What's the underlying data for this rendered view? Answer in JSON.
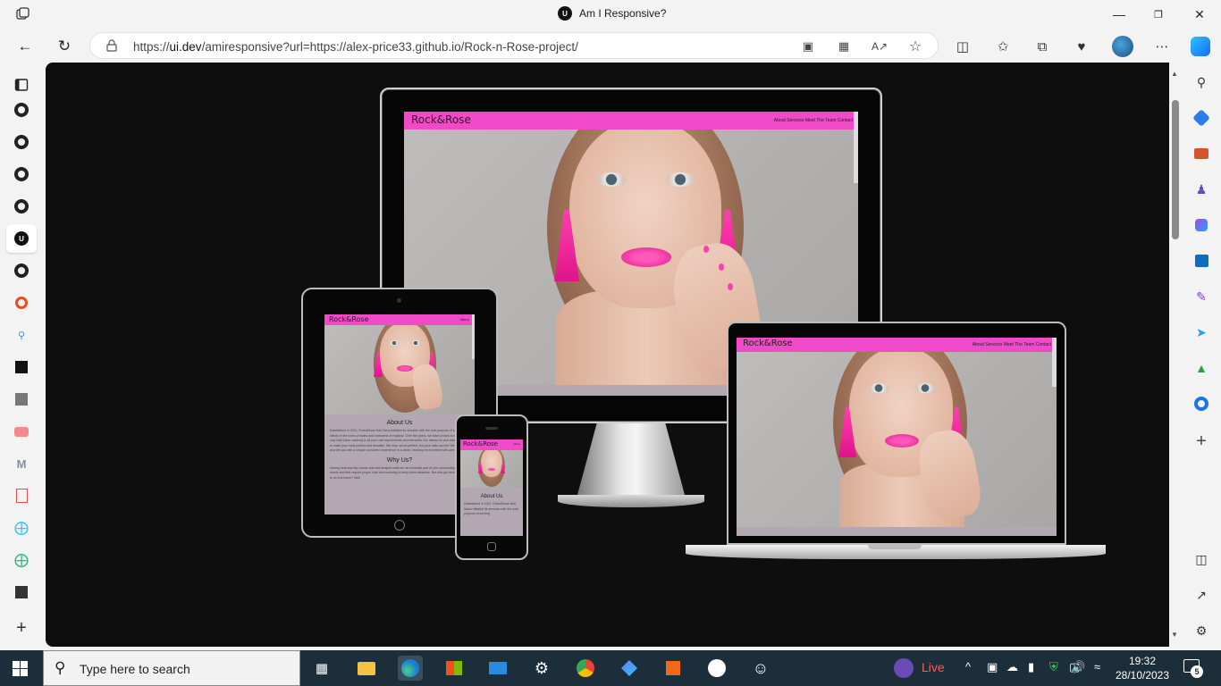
{
  "browser": {
    "tab_title": "Am I Responsive?",
    "url_prefix": "https://",
    "url_host": "ui.dev",
    "url_rest": "/amiresponsive?url=https://alex-price33.github.io/Rock-n-Rose-project/"
  },
  "sites": {
    "desktop": {
      "logo": "Rock&Rose",
      "nav_links": "About  Services  Meet The Team  Contact"
    },
    "laptop": {
      "logo": "Rock&Rose",
      "nav_links": "About  Services  Meet The Team  Contact"
    },
    "tablet": {
      "logo": "Rock&Rose",
      "menu": "Menu",
      "about_heading": "About Us",
      "about_text": "Established in 2011, Rock&Rose Nail Salon initiated its services with the sole purpose of serving clients in the north of wales and northwest of england. Over the years, we have proved to be the only Nail Salon catering to all your nail requirements and demands.Our mission is and always will be to make your nails perfect and beautiful. We may not be perfect, but your nails can be! We strive to provide you with a unique consumer experience in a clean, relaxing environment with care-to-detail.",
      "why_heading": "Why Us?",
      "why_text": "Having neat and tidy hands with well-shaped nails are an essential part of your personality. Our hands and feet require proper care and nurturing to keep them attractive. But who got enough time to do it at home? With"
    },
    "phone": {
      "logo": "Rock&Rose",
      "menu": "Menu",
      "about_heading": "About Us",
      "about_text": "Established in 2011, Rock&Rose Nail Salon initiated its services with the sole purpose of serving"
    }
  },
  "taskbar": {
    "search_placeholder": "Type here to search",
    "live_label": "Live",
    "time": "19:32",
    "date": "28/10/2023",
    "notifications": "5"
  },
  "colors": {
    "brand_pink": "#f04ac9",
    "section_mauve": "#b3a7b1",
    "taskbar": "#1c2e3a"
  }
}
